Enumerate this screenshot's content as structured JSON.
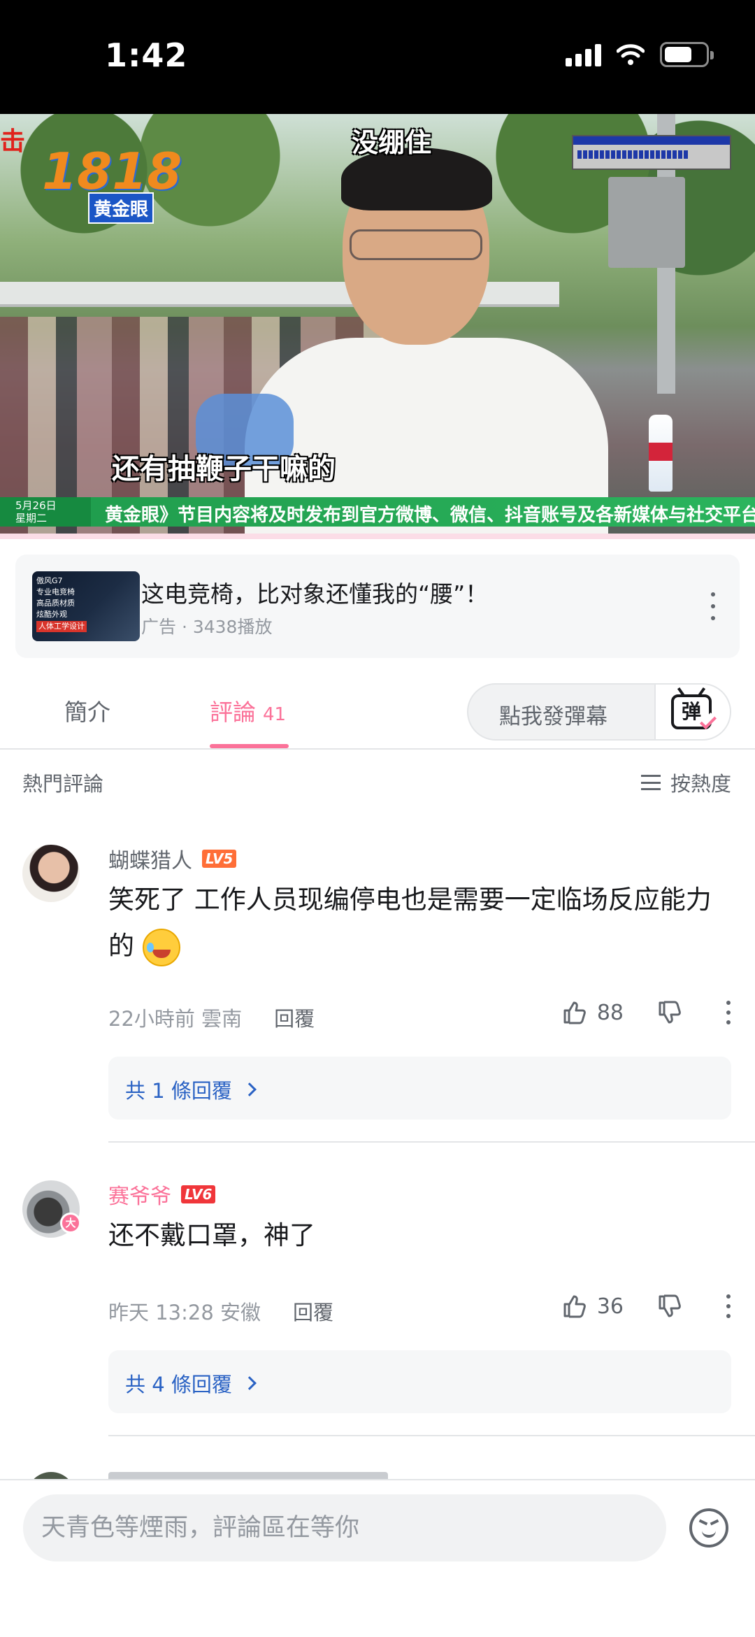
{
  "status_bar": {
    "time": "1:42"
  },
  "video": {
    "subtitle_top": "没绷住",
    "subtitle_bottom": "还有抽鞭子干嘛的",
    "logo_number": "1818",
    "logo_tag": "黄金眼",
    "red_mark": "击",
    "date_line1": "5月26日",
    "date_line2": "星期二",
    "ticker_text": "黄金眼》节目内容将及时发布到官方微博、微信、抖音账号及各新媒体与社交平台"
  },
  "ad": {
    "thumb_lines": [
      "傲风G7",
      "专业电竞椅",
      "高品质材质",
      "炫酷外观",
      "人体工学设计"
    ],
    "title": "这电竞椅，比对象还懂我的“腰”！",
    "meta": "广告 · 3438播放"
  },
  "tabs": {
    "intro": "簡介",
    "comments": "評論",
    "comment_count": "41",
    "danmaku_placeholder": "點我發彈幕",
    "danmaku_icon_char": "弹"
  },
  "section": {
    "title": "熱門評論",
    "sort_label": "按熱度"
  },
  "comments": [
    {
      "username": "蝴蝶猎人",
      "level": "LV5",
      "text": "笑死了 工作人员现编停电也是需要一定临场反应能力的",
      "time_location": "22小時前 雲南",
      "reply_label": "回覆",
      "likes": "88",
      "replies_summary": "共 1 條回覆"
    },
    {
      "username": "赛爷爷",
      "level": "LV6",
      "vip_badge": "大",
      "text": "还不戴口罩，神了",
      "time_location": "昨天 13:28 安徽",
      "reply_label": "回覆",
      "likes": "36",
      "replies_summary": "共 4 條回覆"
    }
  ],
  "input": {
    "placeholder": "天青色等煙雨，評論區在等你"
  },
  "colors": {
    "accent_pink": "#fb7299",
    "link_blue": "#2a62c4",
    "lv5_orange": "#ff6e37",
    "lv6_red": "#f0363a"
  }
}
